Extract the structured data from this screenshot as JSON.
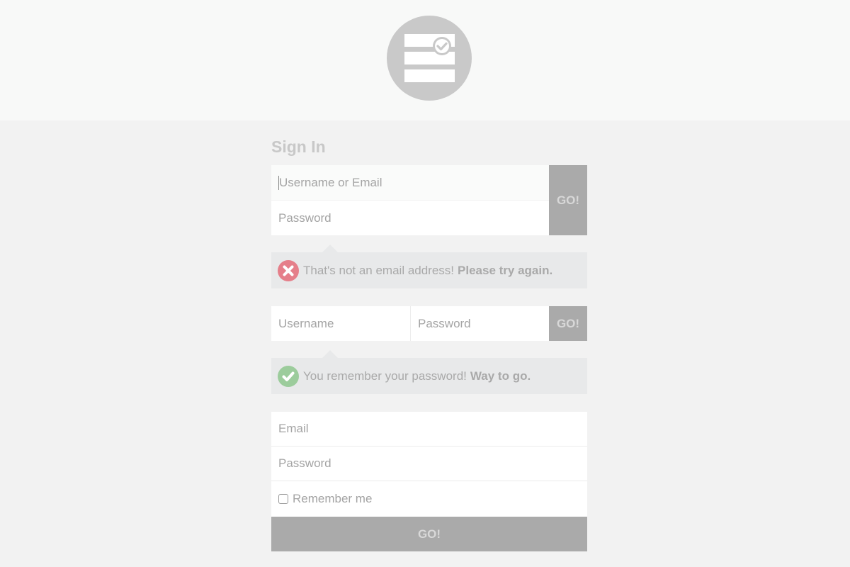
{
  "header": {
    "logo_icon": "server-check-icon"
  },
  "title": "Sign In",
  "form1": {
    "username_placeholder": "Username or Email",
    "password_placeholder": "Password",
    "go_label": "GO!"
  },
  "alert_error": {
    "icon": "error-x-icon",
    "text": "That's not an email address!",
    "emphasis": "Please try again.",
    "color": "#e57f8a"
  },
  "form2": {
    "username_placeholder": "Username",
    "password_placeholder": "Password",
    "go_label": "GO!"
  },
  "alert_success": {
    "icon": "success-check-icon",
    "text": "You remember your password!",
    "emphasis": "Way to go.",
    "color": "#9ccc9c"
  },
  "form3": {
    "email_placeholder": "Email",
    "password_placeholder": "Password",
    "remember_label": "Remember me",
    "go_label": "GO!"
  }
}
